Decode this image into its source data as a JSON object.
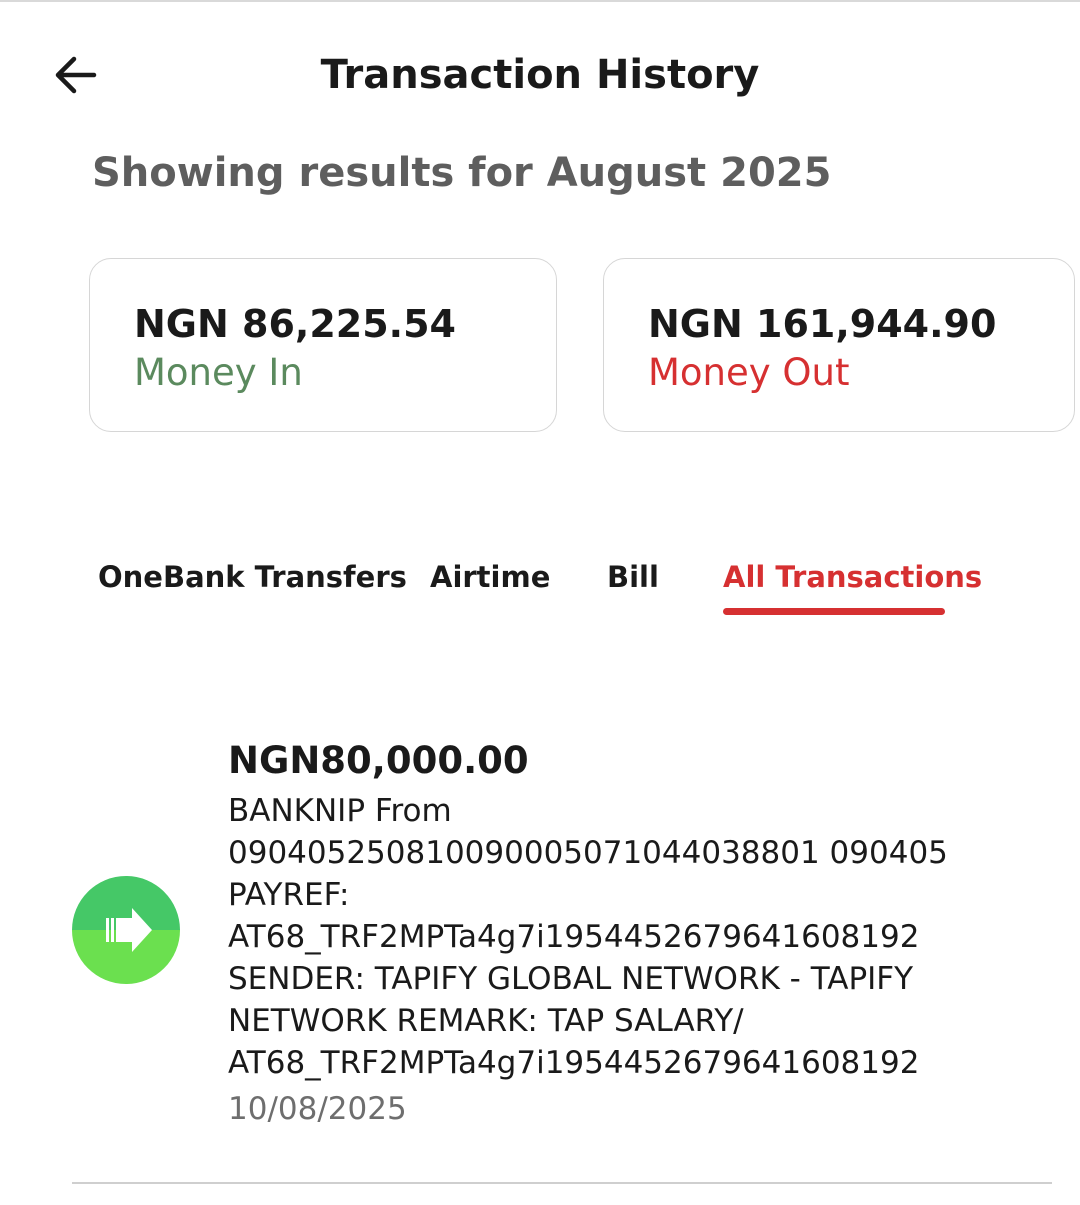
{
  "header": {
    "title": "Transaction History",
    "back_icon": "arrow-left-icon"
  },
  "filter": {
    "caption": "Showing results for August 2025"
  },
  "summary": {
    "money_in": {
      "amount": "NGN 86,225.54",
      "label": "Money In",
      "color": "#5b8a5e"
    },
    "money_out": {
      "amount": "NGN 161,944.90",
      "label": "Money Out",
      "color": "#d63031"
    }
  },
  "tabs": [
    {
      "label": "OneBank Transfers",
      "active": false
    },
    {
      "label": "Airtime",
      "active": false
    },
    {
      "label": "Bill",
      "active": false
    },
    {
      "label": "All Transactions",
      "active": true
    }
  ],
  "transactions": [
    {
      "amount": "NGN80,000.00",
      "icon": "incoming-arrow-icon",
      "description_lines": [
        "BANKNIP From",
        "090405250810090005071044038801 090405",
        "PAYREF:",
        "AT68_TRF2MPTa4g7i1954452679641608192",
        "SENDER: TAPIFY GLOBAL NETWORK - TAPIFY",
        "NETWORK REMARK: TAP SALARY/",
        "AT68_TRF2MPTa4g7i1954452679641608192"
      ],
      "date": "10/08/2025"
    }
  ],
  "colors": {
    "accent": "#d63031",
    "money_in": "#5b8a5e",
    "icon_green_top": "#45c867",
    "icon_green_bottom": "#6be04f"
  }
}
